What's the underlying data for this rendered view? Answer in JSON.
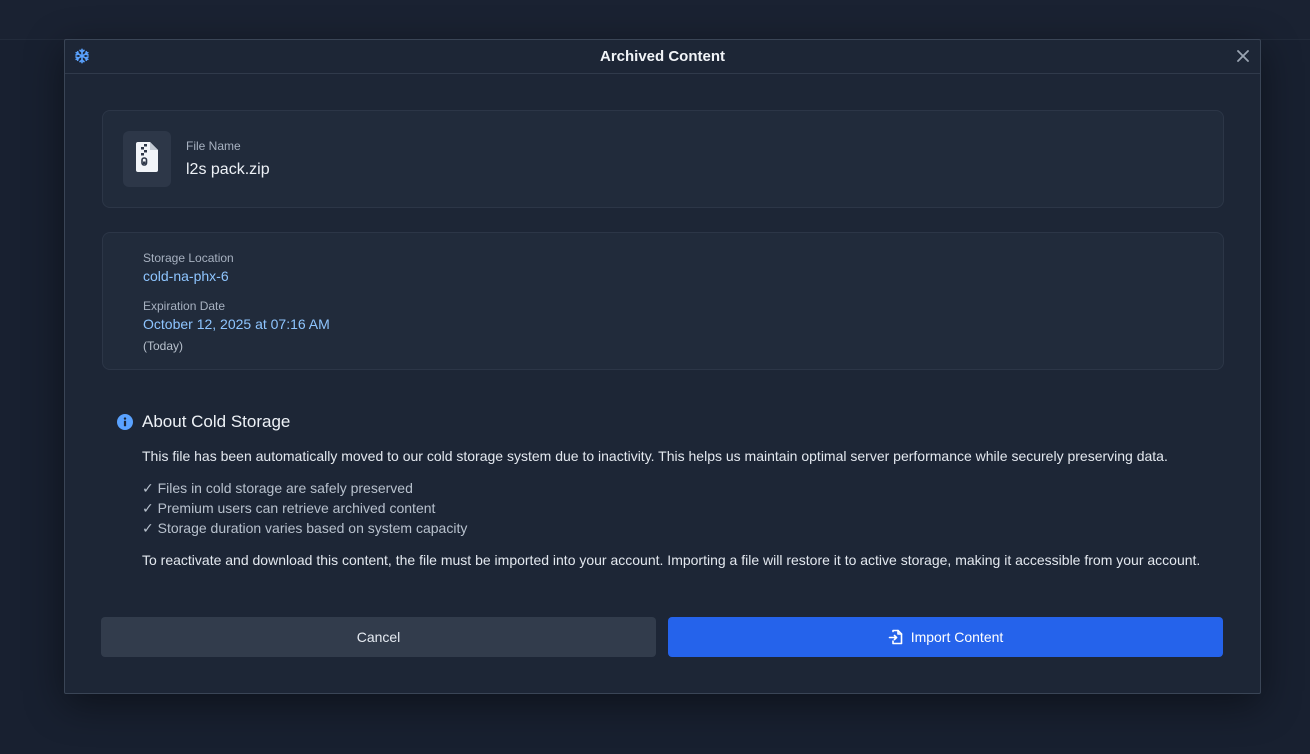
{
  "dialog": {
    "title": "Archived Content",
    "header_icon": "snowflake-icon",
    "close_icon": "close-icon"
  },
  "file": {
    "label": "File Name",
    "name": "l2s pack.zip",
    "icon": "zip-file-icon"
  },
  "storage": {
    "location_label": "Storage Location",
    "location_value": "cold-na-phx-6",
    "expiration_label": "Expiration Date",
    "expiration_value": "October 12, 2025 at 07:16 AM",
    "expiration_note": "(Today)"
  },
  "about": {
    "icon": "info-icon",
    "title": "About Cold Storage",
    "intro": "This file has been automatically moved to our cold storage system due to inactivity. This helps us maintain optimal server performance while securely preserving data.",
    "checks": [
      "✓ Files in cold storage are safely preserved",
      "✓ Premium users can retrieve archived content",
      "✓ Storage duration varies based on system capacity"
    ],
    "outro": "To reactivate and download this content, the file must be imported into your account. Importing a file will restore it to active storage, making it accessible from your account."
  },
  "actions": {
    "cancel_label": "Cancel",
    "import_label": "Import Content",
    "import_icon": "file-import-icon"
  },
  "colors": {
    "accent": "#2563eb",
    "link": "#8ec5ff",
    "surface": "#1d2636",
    "card": "#212b3b"
  }
}
